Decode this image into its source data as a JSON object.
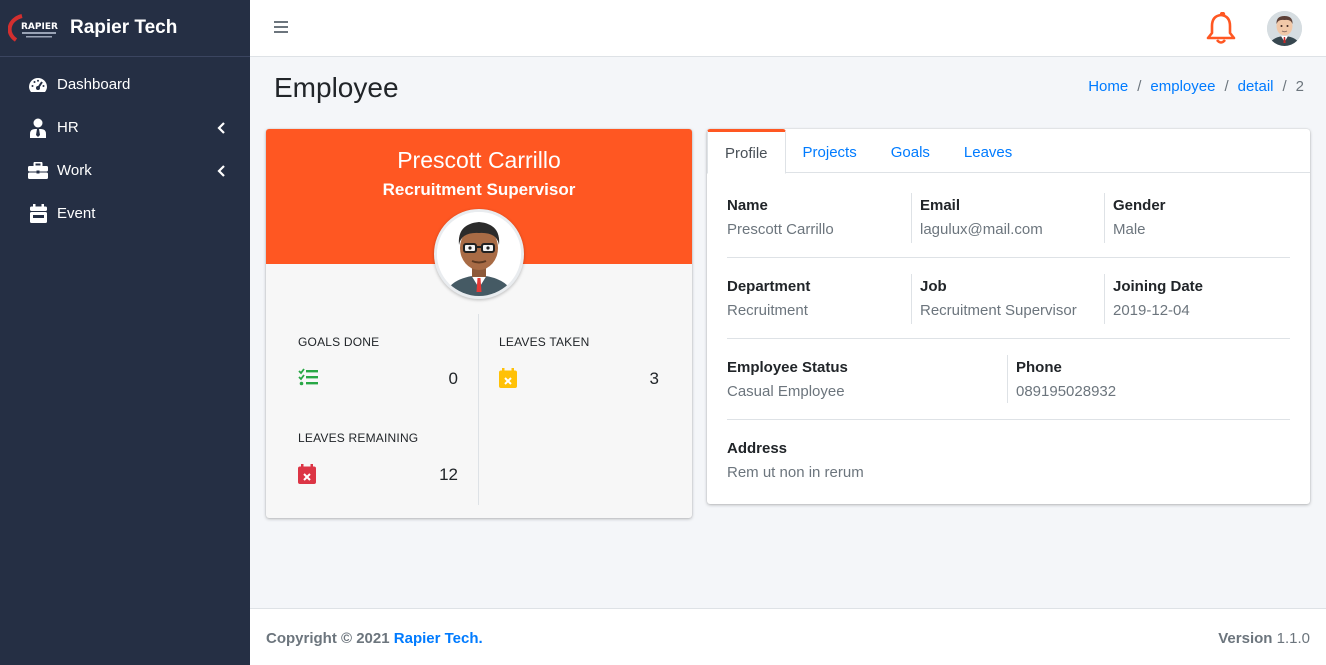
{
  "sidebar": {
    "brand": "Rapier Tech",
    "logo_text": "RAPIER",
    "items": [
      {
        "label": "Dashboard",
        "icon": "tachometer-icon"
      },
      {
        "label": "HR",
        "icon": "user-tie-icon",
        "has_children": true
      },
      {
        "label": "Work",
        "icon": "briefcase-icon",
        "has_children": true
      },
      {
        "label": "Event",
        "icon": "calendar-icon"
      }
    ]
  },
  "header": {
    "menu_icon": "hamburger-icon",
    "notification_icon": "bell-icon",
    "avatar_icon": "user-avatar"
  },
  "page": {
    "title": "Employee",
    "breadcrumb": [
      "Home",
      "employee",
      "detail",
      "2"
    ]
  },
  "profile": {
    "name": "Prescott Carrillo",
    "job": "Recruitment Supervisor",
    "stats": {
      "goals_done": {
        "label": "GOALS DONE",
        "value": "0",
        "icon": "tasks-icon"
      },
      "leaves_taken": {
        "label": "LEAVES TAKEN",
        "value": "3",
        "icon": "calendar-x-icon"
      },
      "leaves_remaining": {
        "label": "LEAVES REMAINING",
        "value": "12",
        "icon": "calendar-times-icon"
      }
    }
  },
  "tabs": [
    "Profile",
    "Projects",
    "Goals",
    "Leaves"
  ],
  "details": {
    "name": {
      "label": "Name",
      "value": "Prescott Carrillo"
    },
    "email": {
      "label": "Email",
      "value": "lagulux@mail.com"
    },
    "gender": {
      "label": "Gender",
      "value": "Male"
    },
    "department": {
      "label": "Department",
      "value": "Recruitment"
    },
    "job": {
      "label": "Job",
      "value": "Recruitment Supervisor"
    },
    "joining_date": {
      "label": "Joining Date",
      "value": "2019-12-04"
    },
    "status": {
      "label": "Employee Status",
      "value": "Casual Employee"
    },
    "phone": {
      "label": "Phone",
      "value": "089195028932"
    },
    "address": {
      "label": "Address",
      "value": "Rem ut non in rerum"
    }
  },
  "footer": {
    "copyright": "Copyright © 2021",
    "brand": "Rapier Tech.",
    "version_label": "Version",
    "version": "1.1.0"
  },
  "colors": {
    "accent": "#ff5722",
    "sidebar": "#252f44",
    "link": "#007bff",
    "goals_icon": "#28a745",
    "leaves_taken_icon": "#ffc107",
    "leaves_remaining_icon": "#dc3545"
  }
}
